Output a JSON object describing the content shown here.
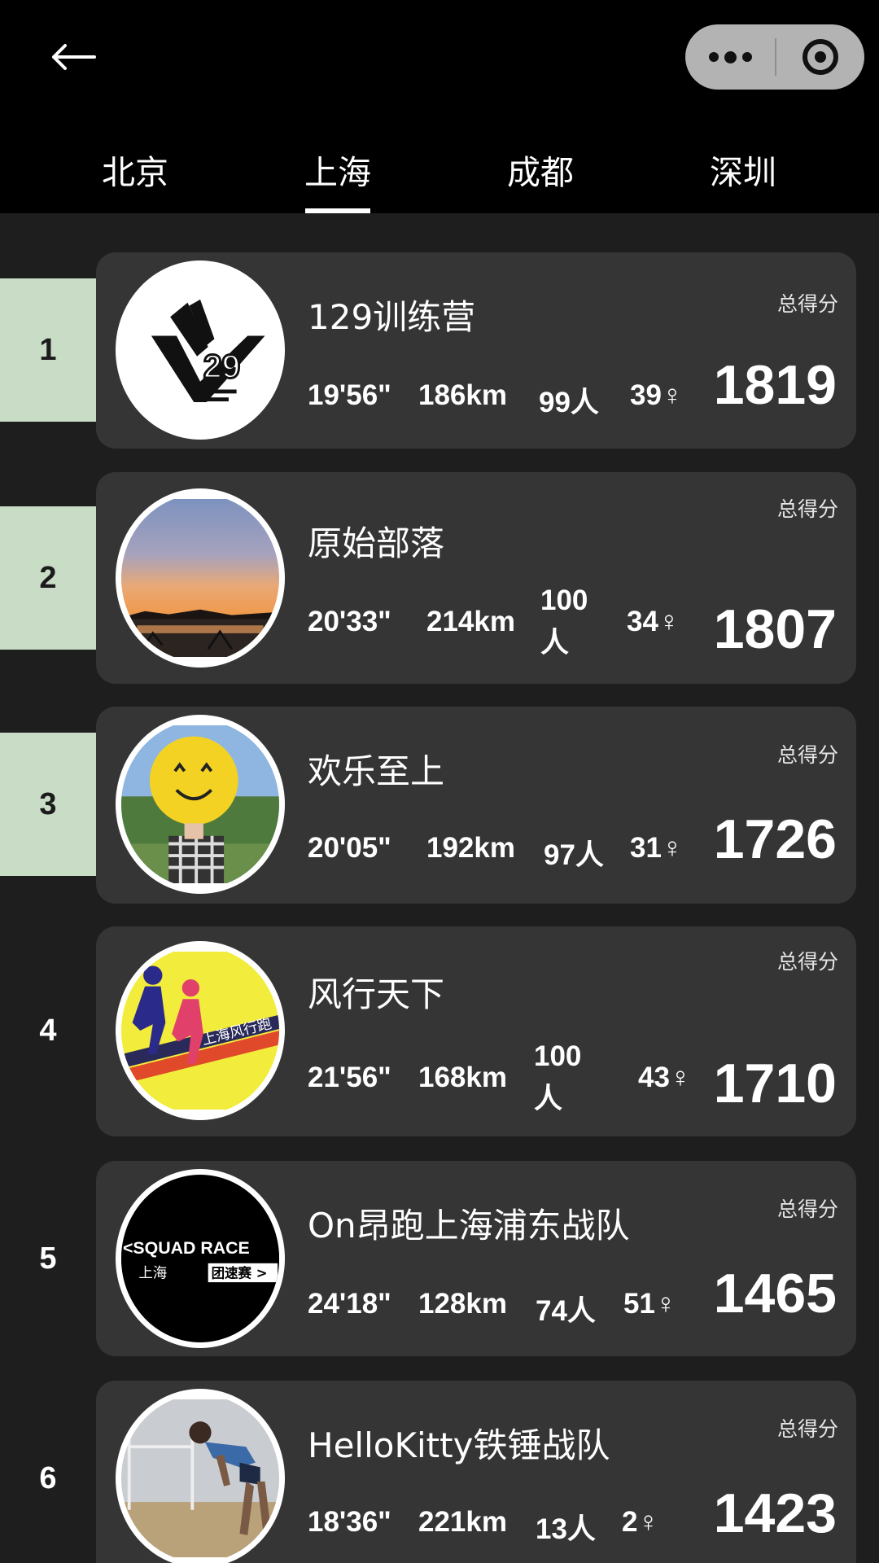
{
  "tabs": [
    {
      "label": "北京",
      "active": false
    },
    {
      "label": "上海",
      "active": true
    },
    {
      "label": "成都",
      "active": false
    },
    {
      "label": "深圳",
      "active": false
    }
  ],
  "score_label": "总得分",
  "teams": [
    {
      "rank": "1",
      "name": "129训练营",
      "pace": "19'56\"",
      "distance": "186km",
      "people": "99人",
      "female": "39♀",
      "score": "1819"
    },
    {
      "rank": "2",
      "name": "原始部落",
      "pace": "20'33\"",
      "distance": "214km",
      "people": "100人",
      "female": "34♀",
      "score": "1807"
    },
    {
      "rank": "3",
      "name": "欢乐至上",
      "pace": "20'05\"",
      "distance": "192km",
      "people": "97人",
      "female": "31♀",
      "score": "1726"
    },
    {
      "rank": "4",
      "name": "风行天下",
      "pace": "21'56\"",
      "distance": "168km",
      "people": "100人",
      "female": "43♀",
      "score": "1710"
    },
    {
      "rank": "5",
      "name": "On昂跑上海浦东战队",
      "pace": "24'18\"",
      "distance": "128km",
      "people": "74人",
      "female": "51♀",
      "score": "1465"
    },
    {
      "rank": "6",
      "name": "HelloKitty铁锤战队",
      "pace": "18'36\"",
      "distance": "221km",
      "people": "13人",
      "female": "2♀",
      "score": "1423"
    }
  ],
  "avatar_text": {
    "squad_race": "<SQUAD RACE",
    "shanghai": "上海",
    "tuan_su_sai": "团速赛 >",
    "fengxing": "上海风行跑"
  },
  "icons": {
    "back": "back-arrow-icon",
    "more": "more-dots-icon",
    "close": "target-circle-icon"
  },
  "colors": {
    "top_rank_bg": "#c8dcc6",
    "card_bg": "#353535",
    "page_bg": "#1e1e1e"
  }
}
